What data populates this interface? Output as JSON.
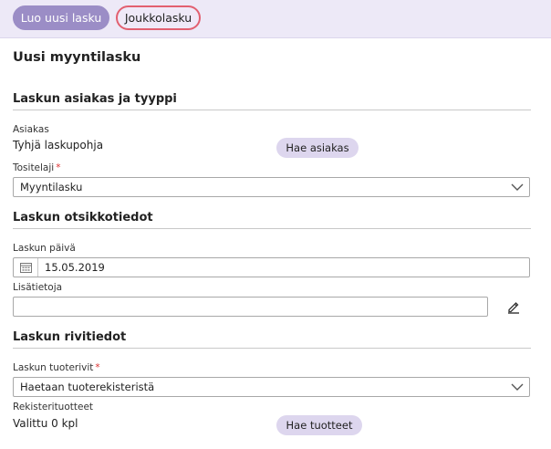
{
  "toolbar": {
    "create_label": "Luo uusi lasku",
    "bulk_label": "Joukkolasku"
  },
  "page": {
    "title": "Uusi myyntilasku"
  },
  "customer_section": {
    "title": "Laskun asiakas ja tyyppi",
    "customer_label": "Asiakas",
    "customer_value": "Tyhjä laskupohja",
    "fetch_customer_label": "Hae asiakas",
    "doc_type_label": "Tositelaji",
    "doc_type_required": "*",
    "doc_type_value": "Myyntilasku"
  },
  "header_section": {
    "title": "Laskun otsikkotiedot",
    "date_label": "Laskun päivä",
    "date_value": "15.05.2019",
    "info_label": "Lisätietoja",
    "info_value": ""
  },
  "rows_section": {
    "title": "Laskun rivitiedot",
    "product_rows_label": "Laskun tuoterivit",
    "product_rows_required": "*",
    "product_rows_value": "Haetaan tuoterekisteristä",
    "registry_label": "Rekisterituotteet",
    "registry_value": "Valittu 0 kpl",
    "fetch_products_label": "Hae tuotteet"
  },
  "icons": {
    "calendar": "calendar-icon",
    "chevron": "chevron-down-icon",
    "edit": "pencil-icon"
  }
}
